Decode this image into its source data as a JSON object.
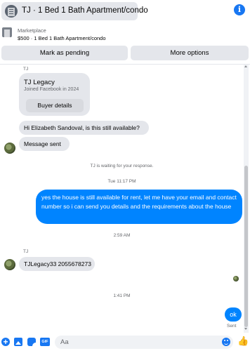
{
  "header": {
    "title": "TJ · 1 Bed 1 Bath Apartment/condo",
    "info_icon": "info-icon"
  },
  "listing": {
    "source": "Marketplace",
    "title": "$500 · 1 Bed 1 Bath Apartment/condo"
  },
  "actions": {
    "mark_pending": "Mark as pending",
    "more_options": "More options"
  },
  "thread": {
    "sender_top": "TJ",
    "intro_card": {
      "name": "TJ Legacy",
      "subtitle": "Joined Facebook in 2024",
      "button": "Buyer details"
    },
    "msg_available": "Hi Elizabeth Sandoval, is this still available?",
    "msg_sent": "Message sent",
    "waiting_note": "TJ is waiting for your response.",
    "time_1": "Tue 11:17 PM",
    "reply_out": "yes the house is still available for rent, let me have your email  and contact number so i can send you details and the requirements about the house",
    "time_2": "2:59 AM",
    "sender_mid": "TJ",
    "msg_contact": "TJLegacy33 2055678273",
    "time_3": "1:41 PM",
    "reply_ok": "ok",
    "sent_status": "Sent"
  },
  "composer": {
    "placeholder": "Aa",
    "icons": [
      "plus-circle-icon",
      "photo-icon",
      "sticker-icon",
      "gif-icon",
      "emoji-icon",
      "thumbs-up-icon"
    ]
  },
  "colors": {
    "accent": "#0084ff",
    "brand": "#1877f2",
    "bubble_in": "#e4e6eb"
  }
}
